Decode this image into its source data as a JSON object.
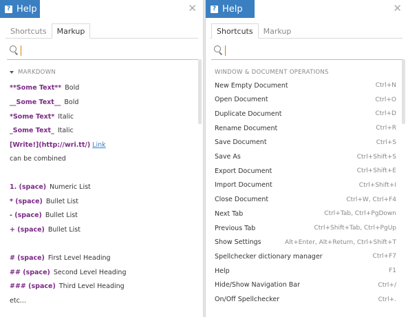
{
  "left": {
    "title": "Help",
    "tabs": [
      "Shortcuts",
      "Markup"
    ],
    "active_tab": "Markup",
    "search_placeholder": "",
    "section": "MARKDOWN",
    "rows": [
      {
        "syntax": "**Some Text**",
        "desc": "Bold"
      },
      {
        "syntax": "__Some Text__",
        "desc": "Bold"
      },
      {
        "syntax": "*Some Text*",
        "desc": "Italic"
      },
      {
        "syntax": "_Some Text_",
        "desc": "Italic"
      },
      {
        "syntax": "[Write!](http://wri.tt/)",
        "link": "Link"
      },
      {
        "plain": "can be combined"
      },
      {
        "syntax": "1. (space)",
        "desc": "Numeric List"
      },
      {
        "syntax": "* (space)",
        "desc": "Bullet List"
      },
      {
        "syntax": "- (space)",
        "desc": "Bullet List"
      },
      {
        "syntax": "+ (space)",
        "desc": "Bullet List"
      },
      {
        "syntax": "# (space)",
        "desc": "First Level Heading"
      },
      {
        "syntax": "## (space)",
        "desc": "Second Level Heading"
      },
      {
        "syntax": "### (space)",
        "desc": "Third Level Heading"
      },
      {
        "plain": "etc..."
      }
    ]
  },
  "right": {
    "title": "Help",
    "tabs": [
      "Shortcuts",
      "Markup"
    ],
    "active_tab": "Shortcuts",
    "search_placeholder": "",
    "section": "WINDOW & DOCUMENT OPERATIONS",
    "shortcuts": [
      {
        "name": "New Empty Document",
        "key": "Ctrl+N"
      },
      {
        "name": "Open Document",
        "key": "Ctrl+O"
      },
      {
        "name": "Duplicate Document",
        "key": "Ctrl+D"
      },
      {
        "name": "Rename Document",
        "key": "Ctrl+R"
      },
      {
        "name": "Save Document",
        "key": "Ctrl+S"
      },
      {
        "name": "Save As",
        "key": "Ctrl+Shift+S"
      },
      {
        "name": "Export Document",
        "key": "Ctrl+Shift+E"
      },
      {
        "name": "Import Document",
        "key": "Ctrl+Shift+I"
      },
      {
        "name": "Close Document",
        "key": "Ctrl+W, Ctrl+F4"
      },
      {
        "name": "Next Tab",
        "key": "Ctrl+Tab, Ctrl+PgDown"
      },
      {
        "name": "Previous Tab",
        "key": "Ctrl+Shift+Tab, Ctrl+PgUp"
      },
      {
        "name": "Show Settings",
        "key": "Alt+Enter, Alt+Return, Ctrl+Shift+T"
      },
      {
        "name": "Spellchecker dictionary manager",
        "key": "Ctrl+F7"
      },
      {
        "name": "Help",
        "key": "F1"
      },
      {
        "name": "Hide/Show Navigation Bar",
        "key": "Ctrl+/"
      },
      {
        "name": "On/Off Spellchecker",
        "key": "Ctrl+."
      }
    ]
  },
  "colors": {
    "accent": "#3a7fc1",
    "markup": "#7b2a86"
  }
}
